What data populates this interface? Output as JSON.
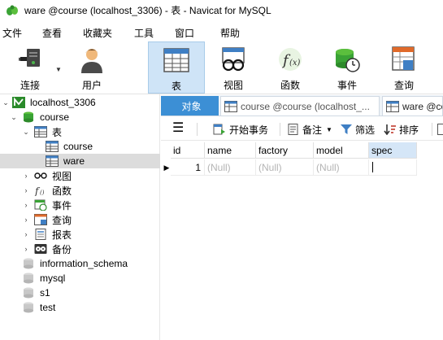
{
  "window": {
    "title": "ware @course (localhost_3306) - 表 - Navicat for MySQL"
  },
  "menu": [
    "文件",
    "查看",
    "收藏夹",
    "工具",
    "窗口",
    "帮助"
  ],
  "toolbar": {
    "connect": "连接",
    "user": "用户",
    "table": "表",
    "view": "视图",
    "function": "函数",
    "event": "事件",
    "query": "查询"
  },
  "tree": {
    "connection": "localhost_3306",
    "database": "course",
    "tables_folder": "表",
    "tables": [
      "course",
      "ware"
    ],
    "views": "视图",
    "functions": "函数",
    "events": "事件",
    "queries": "查询",
    "reports": "报表",
    "backups": "备份",
    "other_dbs": [
      "information_schema",
      "mysql",
      "s1",
      "test"
    ]
  },
  "tabs": {
    "objects": "对象",
    "course_tab": "course @course (localhost_...",
    "ware_tab": "ware @co"
  },
  "subtoolbar": {
    "begin_tx": "开始事务",
    "memo": "备注",
    "filter": "筛选",
    "sort": "排序"
  },
  "grid": {
    "columns": [
      "id",
      "name",
      "factory",
      "model",
      "spec"
    ],
    "rows": [
      [
        "1",
        "(Null)",
        "(Null)",
        "(Null)",
        ""
      ]
    ]
  },
  "colors": {
    "accent": "#3c8fd5",
    "tool_active": "#cfe4f7"
  }
}
